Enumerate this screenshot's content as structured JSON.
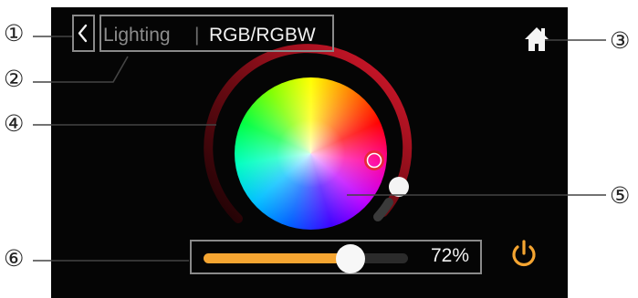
{
  "callouts": [
    "①",
    "②",
    "③",
    "④",
    "⑤",
    "⑥"
  ],
  "header": {
    "back_icon": "chevron-left-icon",
    "breadcrumb_parent": "Lighting",
    "separator": "|",
    "breadcrumb_current": "RGB/RGBW",
    "home_icon": "home-icon"
  },
  "brightness": {
    "percent_label": "72%",
    "level": 0.72
  },
  "power_icon": "power-icon",
  "colors": {
    "accent_orange": "#f5a531",
    "ring_red": "#e0182d",
    "screen_bg": "#050505",
    "selector_ring": "#e8283a"
  }
}
